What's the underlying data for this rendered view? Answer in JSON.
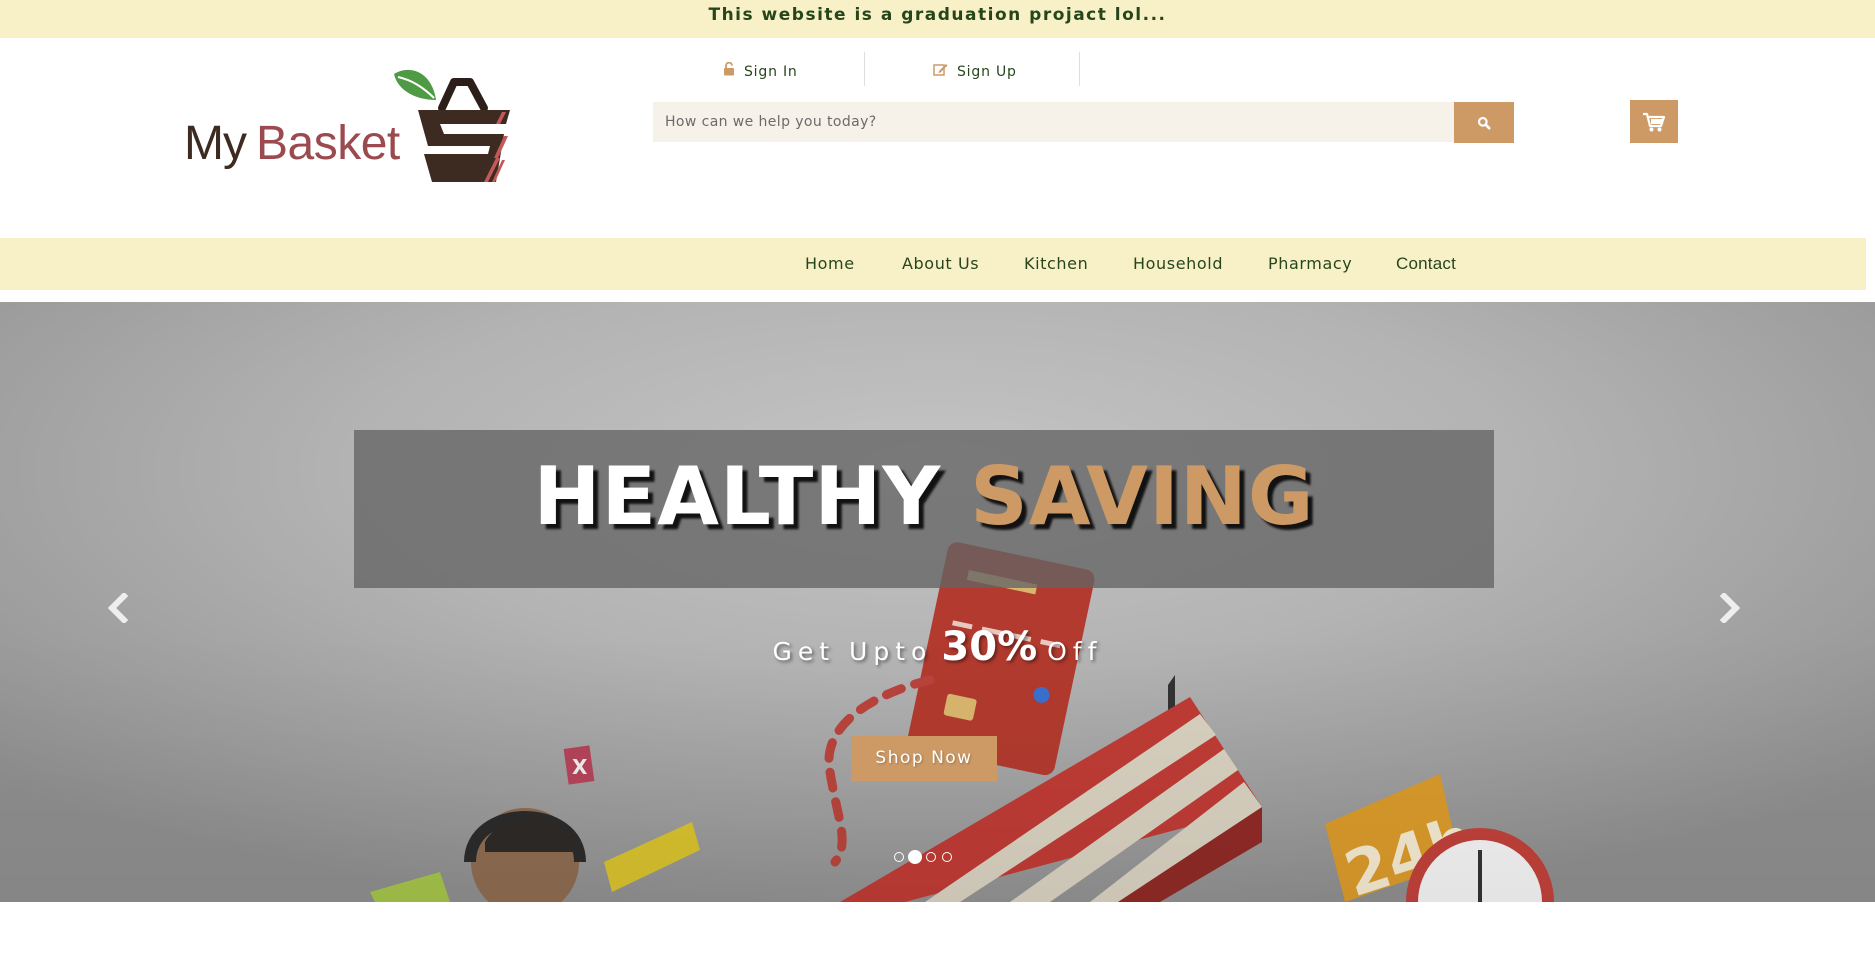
{
  "top_banner": {
    "text": "This website is a graduation projact lol..."
  },
  "logo": {
    "word1": "My",
    "word2": "Basket"
  },
  "auth": {
    "sign_in": "Sign In",
    "sign_up": "Sign Up"
  },
  "search": {
    "placeholder": "How can we help you today?",
    "value": ""
  },
  "nav": {
    "items": [
      {
        "label": "Home"
      },
      {
        "label": "About Us"
      },
      {
        "label": "Kitchen"
      },
      {
        "label": "Household"
      },
      {
        "label": "Pharmacy"
      },
      {
        "label": "Contact"
      }
    ]
  },
  "hero": {
    "title_white": "HEALTHY",
    "title_accent": "SAVING",
    "sub_prefix": "Get Upto",
    "sub_percent": "30%",
    "sub_suffix": "Off",
    "cta": "Shop Now",
    "slides_total": 4,
    "active_slide": 2
  },
  "colors": {
    "banner_bg": "#f8f1c8",
    "text_green": "#27451b",
    "accent": "#cd9a66",
    "logo_red": "#9b4a4f",
    "logo_brown": "#3d2b22"
  },
  "icons": {
    "sign_in": "unlock-icon",
    "sign_up": "edit-icon",
    "search": "search-icon",
    "cart": "cart-icon",
    "prev": "chevron-left-icon",
    "next": "chevron-right-icon"
  }
}
